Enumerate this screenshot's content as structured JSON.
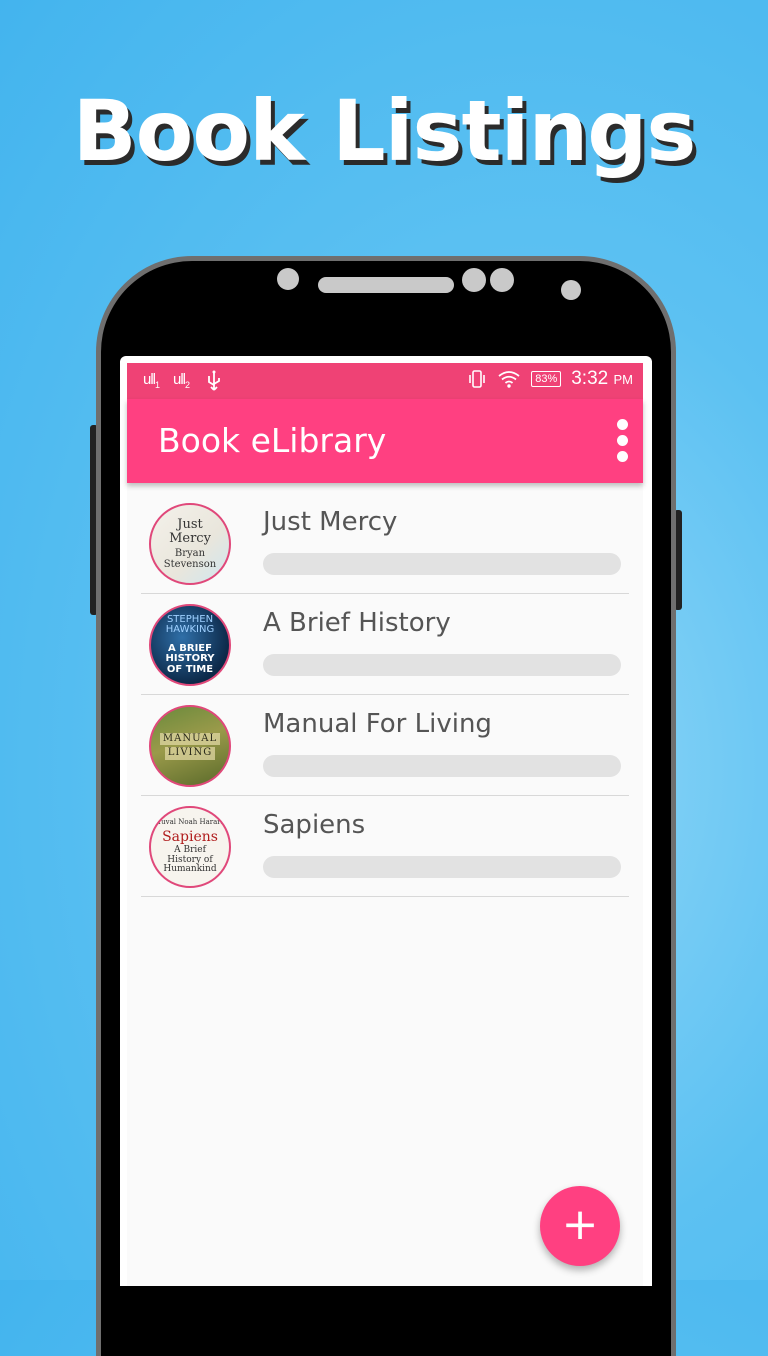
{
  "promo": {
    "headline": "Book Listings"
  },
  "status_bar": {
    "signal_1": "ull",
    "signal_1_sub": "1",
    "signal_2": "ull",
    "signal_2_sub": "2",
    "usb_icon": "usb-icon",
    "vibrate_icon": "vibrate-icon",
    "wifi_icon": "wifi-icon",
    "battery": "83%",
    "time": "3:32",
    "ampm": "PM"
  },
  "toolbar": {
    "title": "Book eLibrary",
    "menu_icon": "more-vert-icon"
  },
  "books": [
    {
      "title": "Just Mercy",
      "cover_lines": [
        "Just",
        "Mercy",
        "Bryan",
        "Stevenson"
      ],
      "progress": 0
    },
    {
      "title": "A Brief History",
      "cover_lines": [
        "STEPHEN",
        "HAWKING",
        "A BRIEF",
        "HISTORY",
        "OF TIME"
      ],
      "progress": 0
    },
    {
      "title": "Manual For Living",
      "cover_lines": [
        "MANUAL",
        "LIVING"
      ],
      "progress": 0
    },
    {
      "title": "Sapiens",
      "cover_lines": [
        "Yuval Noah Harari",
        "Sapiens",
        "A Brief",
        "History of",
        "Humankind"
      ],
      "progress": 0
    }
  ],
  "fab": {
    "label": "+",
    "icon": "add-icon"
  },
  "colors": {
    "primary": "#ff4081",
    "status_bar": "#ef4275",
    "background": "#5cc1f2"
  }
}
